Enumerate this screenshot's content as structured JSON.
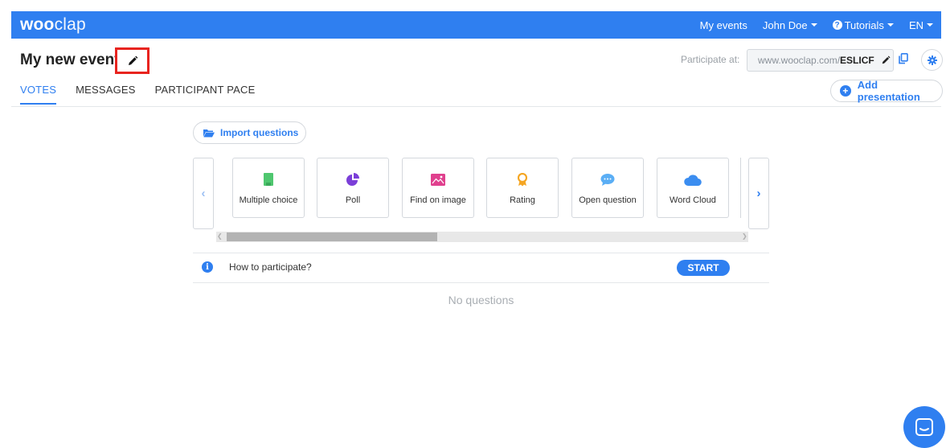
{
  "app": {
    "logo_bold": "woo",
    "logo_light": "clap"
  },
  "topnav": {
    "my_events": "My events",
    "user": "John Doe",
    "tutorials": "Tutorials",
    "language": "EN"
  },
  "header": {
    "title": "My new event",
    "participate_label": "Participate at:",
    "url_prefix": "www.wooclap.com/",
    "event_code": "ESLICF"
  },
  "tabs": [
    {
      "label": "VOTES",
      "active": true
    },
    {
      "label": "MESSAGES",
      "active": false
    },
    {
      "label": "PARTICIPANT PACE",
      "active": false
    }
  ],
  "actions": {
    "add_presentation": "Add presentation",
    "import_questions": "Import questions"
  },
  "question_types": [
    {
      "label": "Multiple choice",
      "icon": "multiple-choice-icon",
      "color": "#4fc76f"
    },
    {
      "label": "Poll",
      "icon": "pie-chart-icon",
      "color": "#7b3fd8"
    },
    {
      "label": "Find on image",
      "icon": "image-icon",
      "color": "#e0408e"
    },
    {
      "label": "Rating",
      "icon": "ribbon-icon",
      "color": "#f5a623"
    },
    {
      "label": "Open question",
      "icon": "speech-bubble-icon",
      "color": "#5aaef5"
    },
    {
      "label": "Word Cloud",
      "icon": "cloud-icon",
      "color": "#3b8df0"
    }
  ],
  "participate": {
    "how_to": "How to participate?",
    "start": "START"
  },
  "empty_state": "No questions",
  "colors": {
    "primary": "#2f7ff0",
    "highlight": "#e8241f"
  }
}
